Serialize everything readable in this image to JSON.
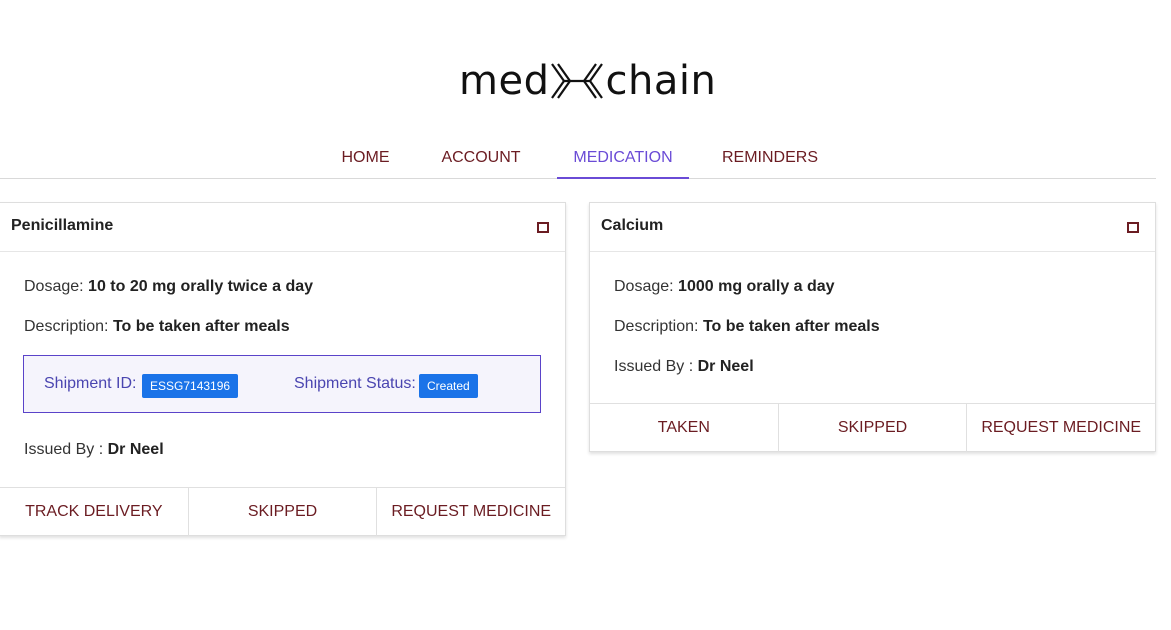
{
  "brand": {
    "part1": "med",
    "part2": "chain",
    "mark_icon": "double-chevron-x-icon"
  },
  "nav": {
    "tabs": [
      {
        "label": "HOME",
        "active": false
      },
      {
        "label": "ACCOUNT",
        "active": false
      },
      {
        "label": "MEDICATION",
        "active": true
      },
      {
        "label": "REMINDERS",
        "active": false
      }
    ]
  },
  "colors": {
    "accent": "#6a4bd6",
    "link": "#6b1c22",
    "badge": "#1a73e8"
  },
  "cards": [
    {
      "title": "Penicillamine",
      "toggle_icon": "square-icon",
      "dosage_label": "Dosage:",
      "dosage_value": "10 to 20 mg orally twice a day",
      "description_label": "Description:",
      "description_value": "To be taken after meals",
      "shipment": {
        "id_label": "Shipment ID:",
        "id_value": "ESSG7143196",
        "status_label": "Shipment Status:",
        "status_value": "Created"
      },
      "issued_label": "Issued By :",
      "issued_value": "Dr Neel",
      "actions": [
        "TRACK DELIVERY",
        "SKIPPED",
        "REQUEST MEDICINE"
      ]
    },
    {
      "title": "Calcium",
      "toggle_icon": "square-icon",
      "dosage_label": "Dosage:",
      "dosage_value": "1000 mg orally a day",
      "description_label": "Description:",
      "description_value": "To be taken after meals",
      "issued_label": "Issued By :",
      "issued_value": "Dr Neel",
      "actions": [
        "TAKEN",
        "SKIPPED",
        "REQUEST MEDICINE"
      ]
    }
  ]
}
